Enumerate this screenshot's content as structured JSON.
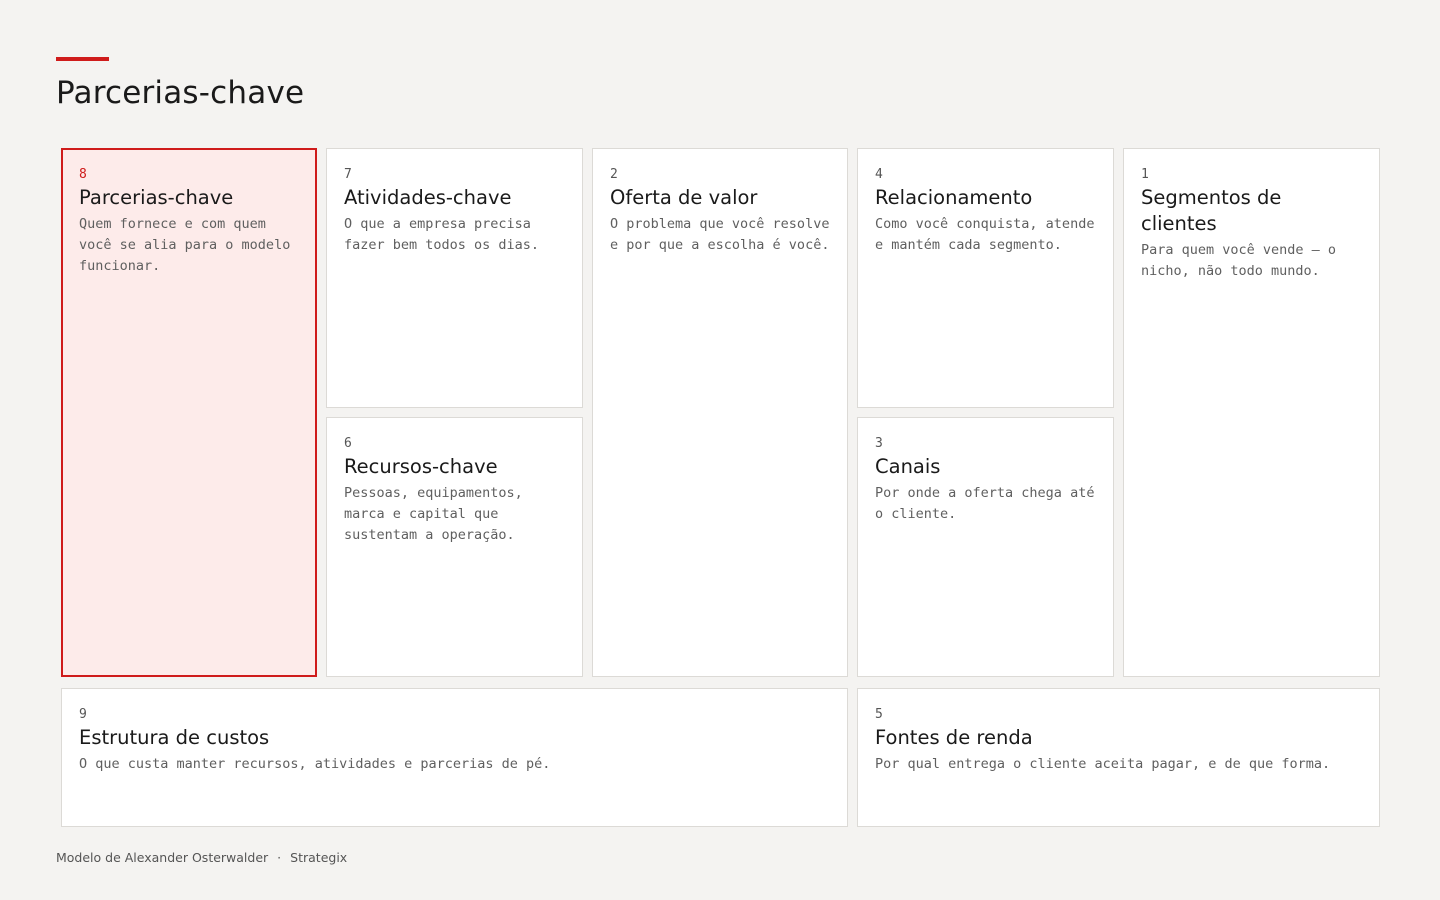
{
  "header": {
    "title": "Parcerias-chave"
  },
  "colors": {
    "accent": "#cf1b1b",
    "active_background": "#fdebea",
    "page_background": "#f4f3f1",
    "card_border": "#dcdad6"
  },
  "blocks": {
    "key_partners": {
      "number": "8",
      "title": "Parcerias-chave",
      "description": "Quem fornece e com quem você se alia para o modelo funcionar.",
      "selected": true
    },
    "key_activities": {
      "number": "7",
      "title": "Atividades-chave",
      "description": "O que a empresa precisa fazer bem todos os dias."
    },
    "key_resources": {
      "number": "6",
      "title": "Recursos-chave",
      "description": "Pessoas, equipamentos, marca e capital que sustentam a operação."
    },
    "value_proposition": {
      "number": "2",
      "title": "Oferta de valor",
      "description": "O problema que você resolve e por que a escolha é você."
    },
    "customer_relationships": {
      "number": "4",
      "title": "Relacionamento",
      "description": "Como você conquista, atende e mantém cada segmento."
    },
    "channels": {
      "number": "3",
      "title": "Canais",
      "description": "Por onde a oferta chega até o cliente."
    },
    "customer_segments": {
      "number": "1",
      "title": "Segmentos de clientes",
      "description": "Para quem você vende — o nicho, não todo mundo."
    },
    "cost_structure": {
      "number": "9",
      "title": "Estrutura de custos",
      "description": "O que custa manter recursos, atividades e parcerias de pé."
    },
    "revenue_streams": {
      "number": "5",
      "title": "Fontes de renda",
      "description": "Por qual entrega o cliente aceita pagar, e de que forma."
    }
  },
  "footer": {
    "credit": "Modelo de Alexander Osterwalder",
    "separator": "·",
    "brand": "Strategix"
  }
}
